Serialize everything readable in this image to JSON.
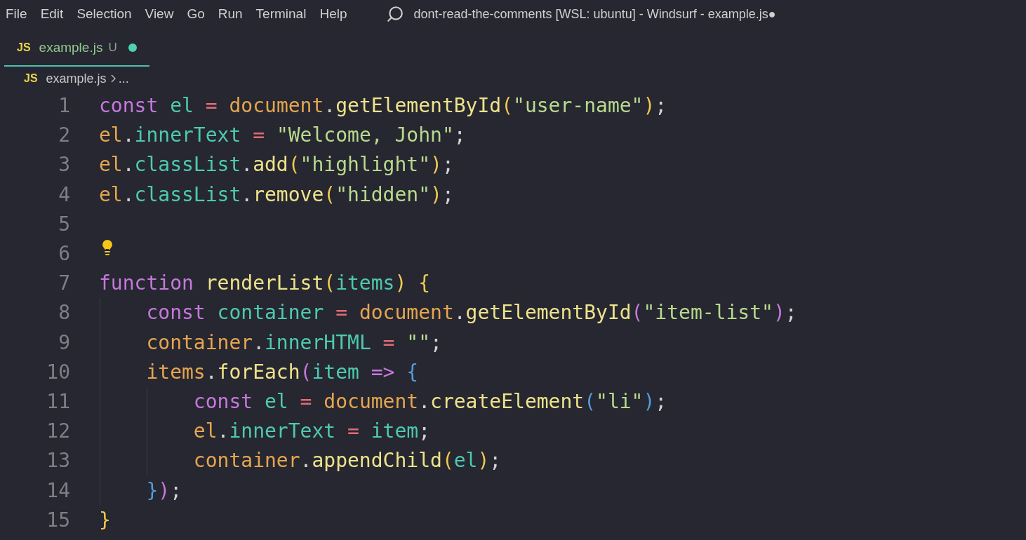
{
  "menu_bar": {
    "items": [
      "File",
      "Edit",
      "Selection",
      "View",
      "Go",
      "Run",
      "Terminal",
      "Help"
    ],
    "title": "dont-read-the-comments [WSL: ubuntu] - Windsurf - example.js●"
  },
  "tabs": [
    {
      "icon": "JS",
      "label": "example.js",
      "status": "U",
      "modified": true,
      "selected": true
    }
  ],
  "breadcrumb": {
    "icon": "JS",
    "file": "example.js",
    "more": "..."
  },
  "editor": {
    "lines": [
      {
        "number": "1",
        "tokens": [
          {
            "text": "const ",
            "color": "#c678dd"
          },
          {
            "text": "el ",
            "color": "#4ec9b0"
          },
          {
            "text": "= ",
            "color": "#e06c75"
          },
          {
            "text": "document",
            "color": "#e5a550"
          },
          {
            "text": ".",
            "color": "#d4d4d4"
          },
          {
            "text": "getElementById",
            "color": "#eee28b"
          },
          {
            "text": "(",
            "color": "#f0c850"
          },
          {
            "text": "\"user-name\"",
            "color": "#b8d98e"
          },
          {
            "text": ")",
            "color": "#f0c850"
          },
          {
            "text": ";",
            "color": "#d4d4d4"
          }
        ]
      },
      {
        "number": "2",
        "tokens": [
          {
            "text": "el",
            "color": "#e5a550"
          },
          {
            "text": ".",
            "color": "#d4d4d4"
          },
          {
            "text": "innerText ",
            "color": "#4ec9b0"
          },
          {
            "text": "= ",
            "color": "#e06c75"
          },
          {
            "text": "\"Welcome, John\"",
            "color": "#b8d98e"
          },
          {
            "text": ";",
            "color": "#d4d4d4"
          }
        ]
      },
      {
        "number": "3",
        "tokens": [
          {
            "text": "el",
            "color": "#e5a550"
          },
          {
            "text": ".",
            "color": "#d4d4d4"
          },
          {
            "text": "classList",
            "color": "#4ec9b0"
          },
          {
            "text": ".",
            "color": "#d4d4d4"
          },
          {
            "text": "add",
            "color": "#eee28b"
          },
          {
            "text": "(",
            "color": "#f0c850"
          },
          {
            "text": "\"highlight\"",
            "color": "#b8d98e"
          },
          {
            "text": ")",
            "color": "#f0c850"
          },
          {
            "text": ";",
            "color": "#d4d4d4"
          }
        ]
      },
      {
        "number": "4",
        "tokens": [
          {
            "text": "el",
            "color": "#e5a550"
          },
          {
            "text": ".",
            "color": "#d4d4d4"
          },
          {
            "text": "classList",
            "color": "#4ec9b0"
          },
          {
            "text": ".",
            "color": "#d4d4d4"
          },
          {
            "text": "remove",
            "color": "#eee28b"
          },
          {
            "text": "(",
            "color": "#f0c850"
          },
          {
            "text": "\"hidden\"",
            "color": "#b8d98e"
          },
          {
            "text": ")",
            "color": "#f0c850"
          },
          {
            "text": ";",
            "color": "#d4d4d4"
          }
        ]
      },
      {
        "number": "5"
      },
      {
        "number": "6",
        "lightbulb": true
      },
      {
        "number": "7",
        "tokens": [
          {
            "text": "function ",
            "color": "#c678dd"
          },
          {
            "text": "renderList",
            "color": "#eee28b"
          },
          {
            "text": "(",
            "color": "#f0c850"
          },
          {
            "text": "items",
            "color": "#4ec9b0"
          },
          {
            "text": ") ",
            "color": "#f0c850"
          },
          {
            "text": "{",
            "color": "#f0c850"
          }
        ]
      },
      {
        "number": "8",
        "tokens": [
          {
            "text": "    const ",
            "color": "#c678dd"
          },
          {
            "text": "container ",
            "color": "#4ec9b0"
          },
          {
            "text": "= ",
            "color": "#e06c75"
          },
          {
            "text": "document",
            "color": "#e5a550"
          },
          {
            "text": ".",
            "color": "#d4d4d4"
          },
          {
            "text": "getElementById",
            "color": "#eee28b"
          },
          {
            "text": "(",
            "color": "#c678dd"
          },
          {
            "text": "\"item-list\"",
            "color": "#b8d98e"
          },
          {
            "text": ")",
            "color": "#c678dd"
          },
          {
            "text": ";",
            "color": "#d4d4d4"
          }
        ]
      },
      {
        "number": "9",
        "tokens": [
          {
            "text": "    container",
            "color": "#e5a550"
          },
          {
            "text": ".",
            "color": "#d4d4d4"
          },
          {
            "text": "innerHTML ",
            "color": "#4ec9b0"
          },
          {
            "text": "= ",
            "color": "#e06c75"
          },
          {
            "text": "\"\"",
            "color": "#b8d98e"
          },
          {
            "text": ";",
            "color": "#d4d4d4"
          }
        ]
      },
      {
        "number": "10",
        "tokens": [
          {
            "text": "    items",
            "color": "#e5a550"
          },
          {
            "text": ".",
            "color": "#d4d4d4"
          },
          {
            "text": "forEach",
            "color": "#eee28b"
          },
          {
            "text": "(",
            "color": "#c678dd"
          },
          {
            "text": "item ",
            "color": "#4ec9b0"
          },
          {
            "text": "=> ",
            "color": "#c678dd"
          },
          {
            "text": "{",
            "color": "#569cd6"
          }
        ]
      },
      {
        "number": "11",
        "tokens": [
          {
            "text": "        const ",
            "color": "#c678dd"
          },
          {
            "text": "el ",
            "color": "#4ec9b0"
          },
          {
            "text": "= ",
            "color": "#e06c75"
          },
          {
            "text": "document",
            "color": "#e5a550"
          },
          {
            "text": ".",
            "color": "#d4d4d4"
          },
          {
            "text": "createElement",
            "color": "#eee28b"
          },
          {
            "text": "(",
            "color": "#569cd6"
          },
          {
            "text": "\"li\"",
            "color": "#b8d98e"
          },
          {
            "text": ")",
            "color": "#569cd6"
          },
          {
            "text": ";",
            "color": "#d4d4d4"
          }
        ]
      },
      {
        "number": "12",
        "tokens": [
          {
            "text": "        el",
            "color": "#e5a550"
          },
          {
            "text": ".",
            "color": "#d4d4d4"
          },
          {
            "text": "innerText ",
            "color": "#4ec9b0"
          },
          {
            "text": "= ",
            "color": "#e06c75"
          },
          {
            "text": "item",
            "color": "#4ec9b0"
          },
          {
            "text": ";",
            "color": "#d4d4d4"
          }
        ]
      },
      {
        "number": "13",
        "tokens": [
          {
            "text": "        container",
            "color": "#e5a550"
          },
          {
            "text": ".",
            "color": "#d4d4d4"
          },
          {
            "text": "appendChild",
            "color": "#eee28b"
          },
          {
            "text": "(",
            "color": "#f0c850"
          },
          {
            "text": "el",
            "color": "#4ec9b0"
          },
          {
            "text": ")",
            "color": "#f0c850"
          },
          {
            "text": ";",
            "color": "#d4d4d4"
          }
        ]
      },
      {
        "number": "14",
        "tokens": [
          {
            "text": "    }",
            "color": "#569cd6"
          },
          {
            "text": ")",
            "color": "#c678dd"
          },
          {
            "text": ";",
            "color": "#d4d4d4"
          }
        ]
      },
      {
        "number": "15",
        "tokens": [
          {
            "text": "}",
            "color": "#f0c850"
          }
        ]
      }
    ]
  }
}
